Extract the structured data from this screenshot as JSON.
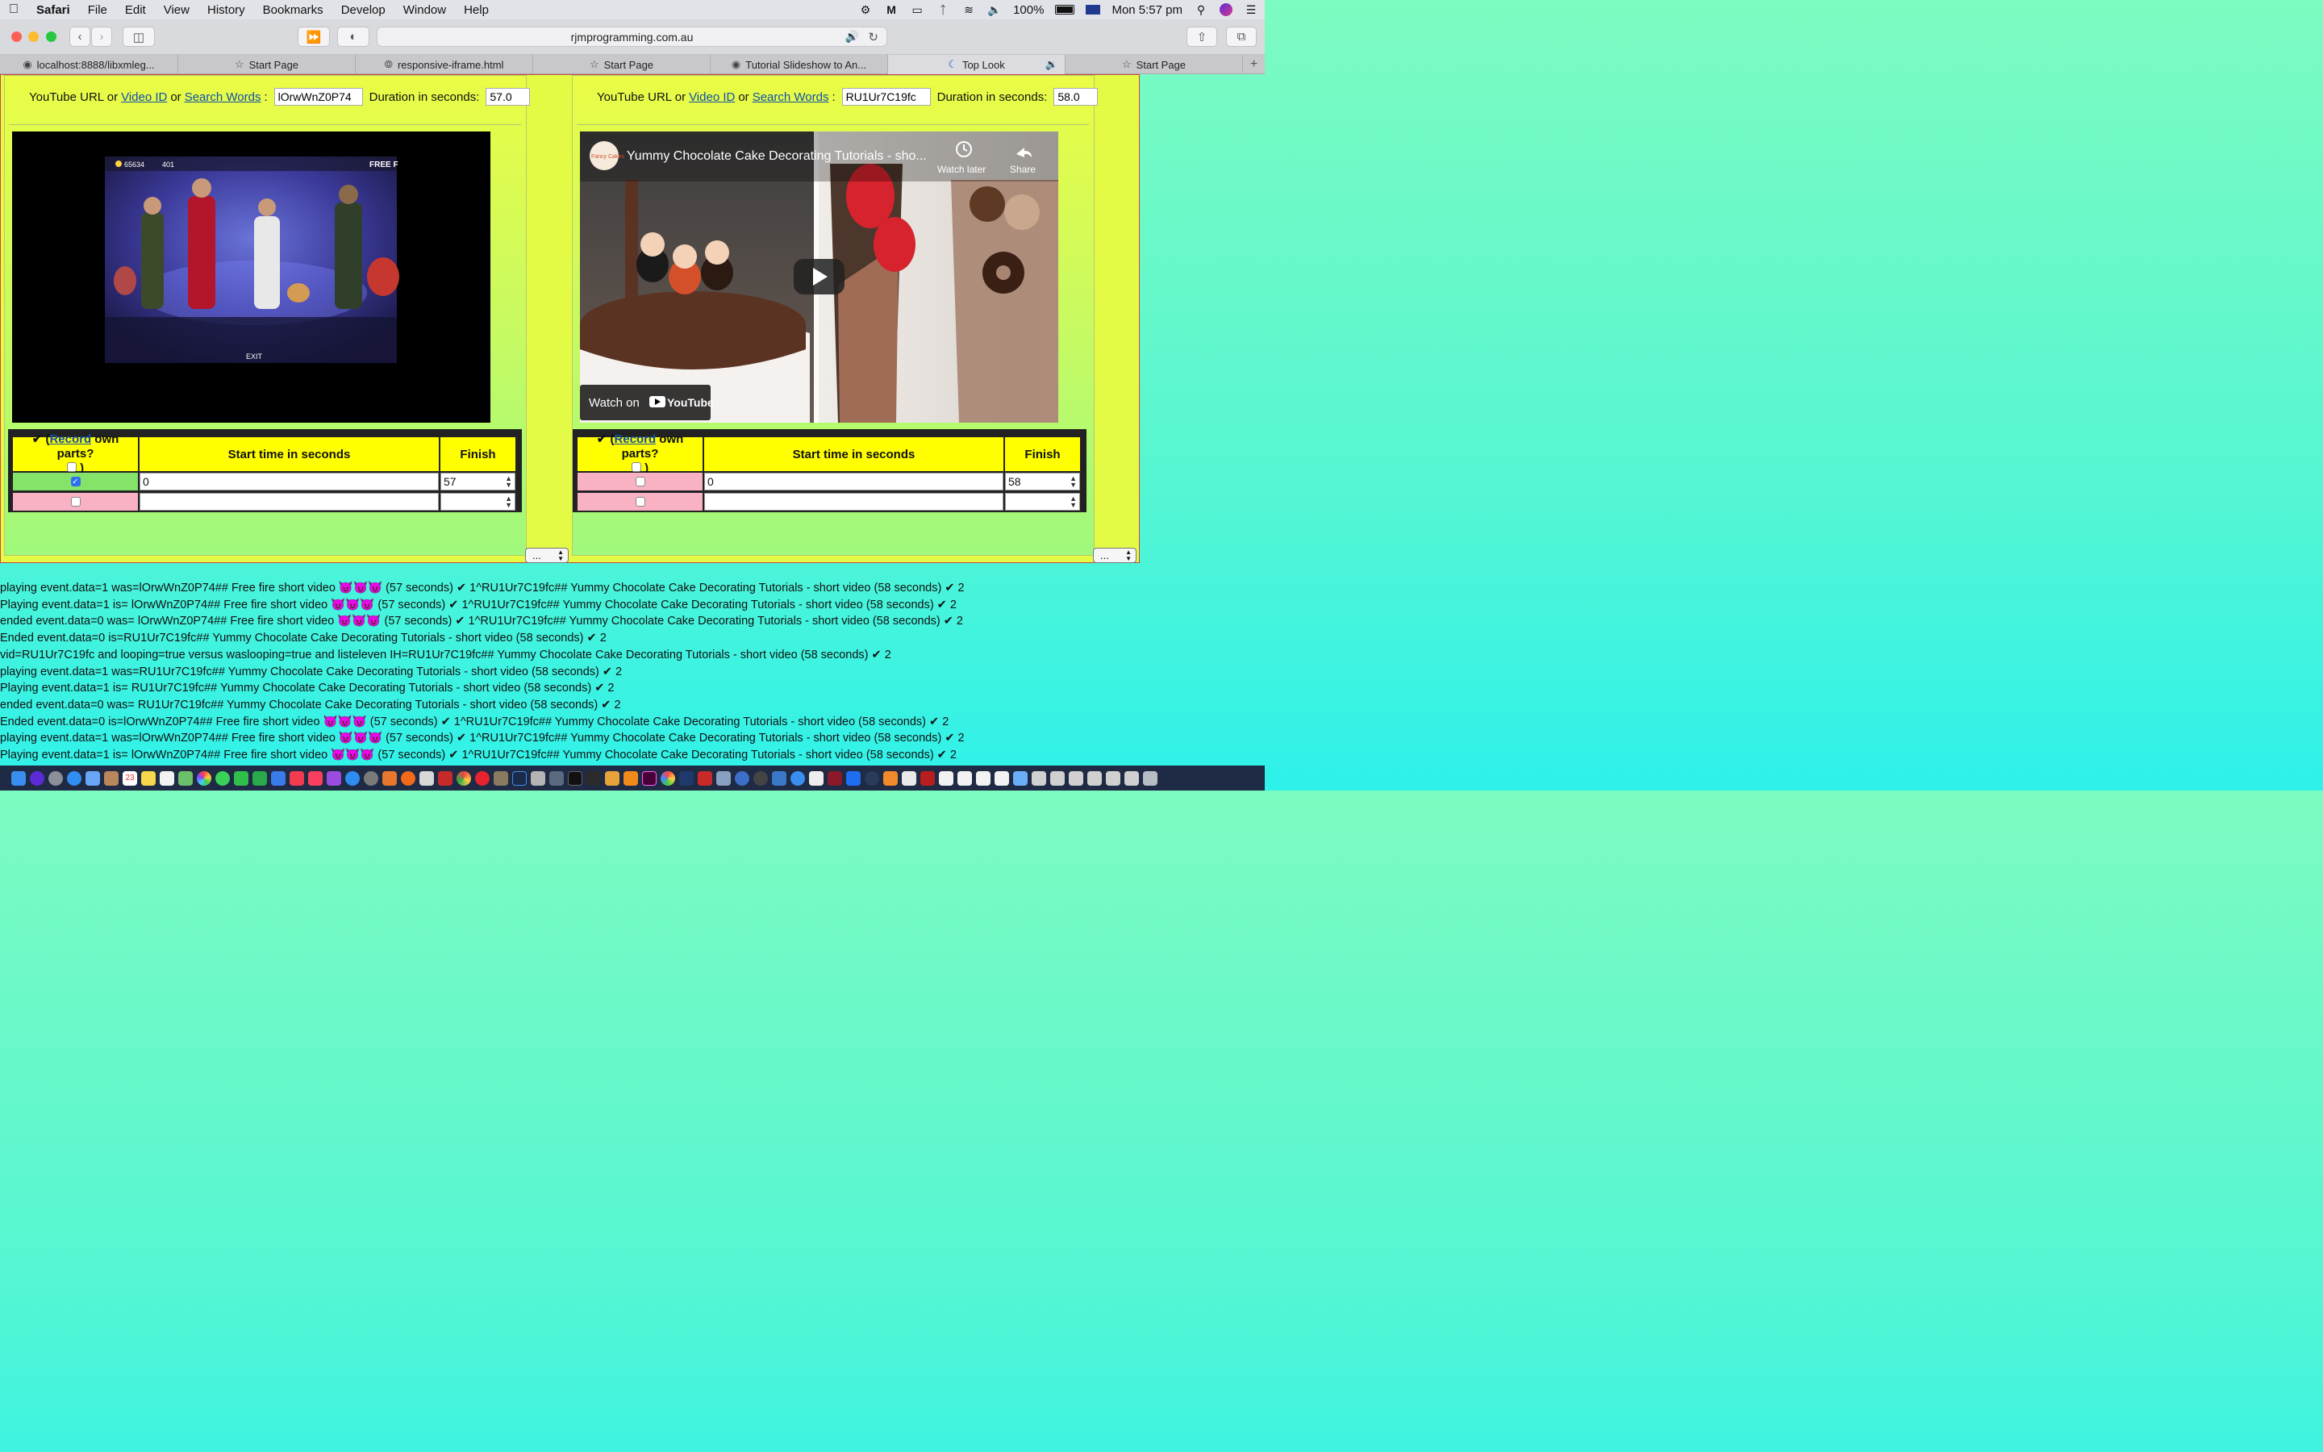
{
  "menubar": {
    "app": "Safari",
    "items": [
      "File",
      "Edit",
      "View",
      "History",
      "Bookmarks",
      "Develop",
      "Window",
      "Help"
    ],
    "battery": "100%",
    "clock": "Mon 5:57 pm"
  },
  "toolbar": {
    "url": "rjmprogramming.com.au"
  },
  "tabs": [
    {
      "label": "localhost:8888/libxmleg...",
      "icon": "elephant-icon"
    },
    {
      "label": "Start Page",
      "icon": "star-icon"
    },
    {
      "label": "responsive-iframe.html",
      "icon": "compass-icon"
    },
    {
      "label": "Start Page",
      "icon": "star-icon"
    },
    {
      "label": "Tutorial Slideshow to An...",
      "icon": "elephant-icon"
    },
    {
      "label": "Top Look",
      "icon": "moon-icon"
    },
    {
      "label": "Start Page",
      "icon": "star-icon"
    }
  ],
  "left": {
    "url_label": "YouTube URL or",
    "video_id_link": "Video ID",
    "or": "or",
    "search_link": "Search Words",
    "colon": ":",
    "video_value": "lOrwWnZ0P74",
    "duration_label": "Duration in seconds:",
    "duration_value": "57.0",
    "col1_pre": "✔ (",
    "col1_link": "Record",
    "col1_post": " own parts?",
    "col1_close": ")",
    "col2": "Start time in seconds",
    "col3": "Finish",
    "row1_start": "0",
    "row1_finish": "57",
    "select": "..."
  },
  "right": {
    "url_label": "YouTube URL or",
    "video_id_link": "Video ID",
    "or": "or",
    "search_link": "Search Words",
    "colon": ":",
    "video_value": "RU1Ur7C19fc",
    "duration_label": "Duration in seconds:",
    "duration_value": "58.0",
    "col1_pre": "✔ (",
    "col1_link": "Record",
    "col1_post": " own parts?",
    "col1_close": ")",
    "col2": "Start time in seconds",
    "col3": "Finish",
    "row1_start": "0",
    "row1_finish": "58",
    "select": "...",
    "yt_title": "Yummy Chocolate Cake Decorating Tutorials - sho...",
    "yt_watch_later": "Watch later",
    "yt_share": "Share",
    "yt_watch_on": "Watch on",
    "yt_brand": "YouTube",
    "yt_channel": "Fancy Cakes"
  },
  "left_video": {
    "hud_count": "65634",
    "hud_level": "401",
    "hud_tag": "FREE F",
    "exit": "EXIT"
  },
  "log": [
    "playing event.data=1 was=lOrwWnZ0P74## Free fire short video 😈😈😈 (57 seconds) ✔ 1^RU1Ur7C19fc## Yummy Chocolate Cake Decorating Tutorials - short video (58 seconds) ✔ 2",
    "Playing event.data=1 is= lOrwWnZ0P74## Free fire short video 😈😈😈 (57 seconds) ✔ 1^RU1Ur7C19fc## Yummy Chocolate Cake Decorating Tutorials - short video (58 seconds) ✔ 2",
    "ended event.data=0 was= lOrwWnZ0P74## Free fire short video 😈😈😈 (57 seconds) ✔ 1^RU1Ur7C19fc## Yummy Chocolate Cake Decorating Tutorials - short video (58 seconds) ✔ 2",
    "Ended event.data=0 is=RU1Ur7C19fc## Yummy Chocolate Cake Decorating Tutorials - short video (58 seconds) ✔ 2",
    "vid=RU1Ur7C19fc and looping=true versus waslooping=true and listeleven IH=RU1Ur7C19fc## Yummy Chocolate Cake Decorating Tutorials - short video (58 seconds) ✔ 2",
    "playing event.data=1 was=RU1Ur7C19fc## Yummy Chocolate Cake Decorating Tutorials - short video (58 seconds) ✔ 2",
    "Playing event.data=1 is= RU1Ur7C19fc## Yummy Chocolate Cake Decorating Tutorials - short video (58 seconds) ✔ 2",
    "ended event.data=0 was= RU1Ur7C19fc## Yummy Chocolate Cake Decorating Tutorials - short video (58 seconds) ✔ 2",
    "Ended event.data=0 is=lOrwWnZ0P74## Free fire short video 😈😈😈 (57 seconds) ✔ 1^RU1Ur7C19fc## Yummy Chocolate Cake Decorating Tutorials - short video (58 seconds) ✔ 2",
    "playing event.data=1 was=lOrwWnZ0P74## Free fire short video 😈😈😈 (57 seconds) ✔ 1^RU1Ur7C19fc## Yummy Chocolate Cake Decorating Tutorials - short video (58 seconds) ✔ 2",
    "Playing event.data=1 is= lOrwWnZ0P74## Free fire short video 😈😈😈 (57 seconds) ✔ 1^RU1Ur7C19fc## Yummy Chocolate Cake Decorating Tutorials - short video (58 seconds) ✔ 2"
  ],
  "dock": {
    "calendar_day": "23"
  },
  "colors": {
    "yellow_header": "#ffff00",
    "green_row": "#86e36a",
    "pink_row": "#f9b2c4",
    "link": "#114fa8"
  }
}
